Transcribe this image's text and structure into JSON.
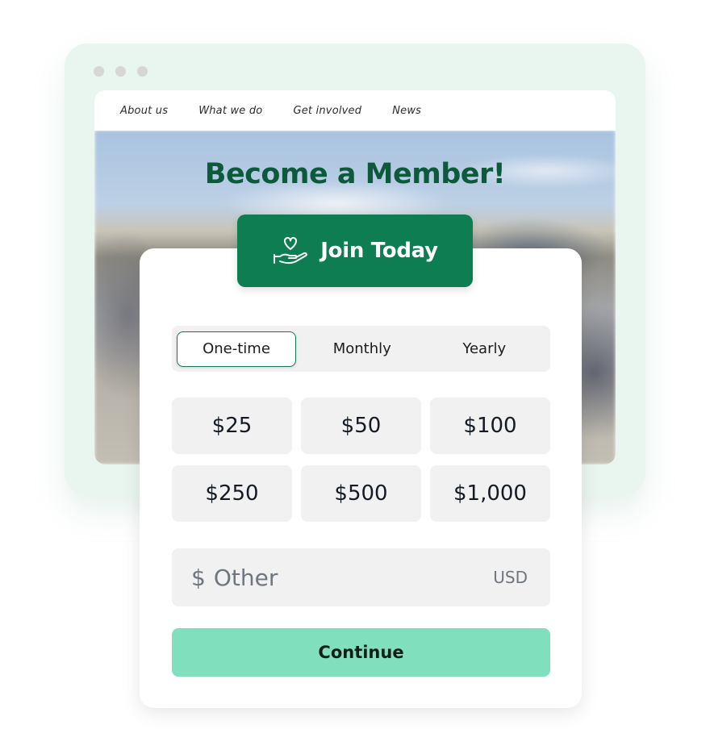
{
  "site": {
    "nav": [
      "About us",
      "What we do",
      "Get involved",
      "News"
    ],
    "hero_title": "Become a Member!"
  },
  "join": {
    "label": "Join Today",
    "icon": "heart-hand-icon"
  },
  "frequency": {
    "options": [
      "One-time",
      "Monthly",
      "Yearly"
    ],
    "selected": "One-time"
  },
  "amounts": [
    "$25",
    "$50",
    "$100",
    "$250",
    "$500",
    "$1,000"
  ],
  "other": {
    "symbol": "$",
    "placeholder": "Other",
    "currency": "USD"
  },
  "continue_label": "Continue",
  "colors": {
    "brand_green": "#0e7d52",
    "title_green": "#0c5a3b",
    "continue_mint": "#80e0be",
    "window_mint": "#e8f6ef"
  }
}
